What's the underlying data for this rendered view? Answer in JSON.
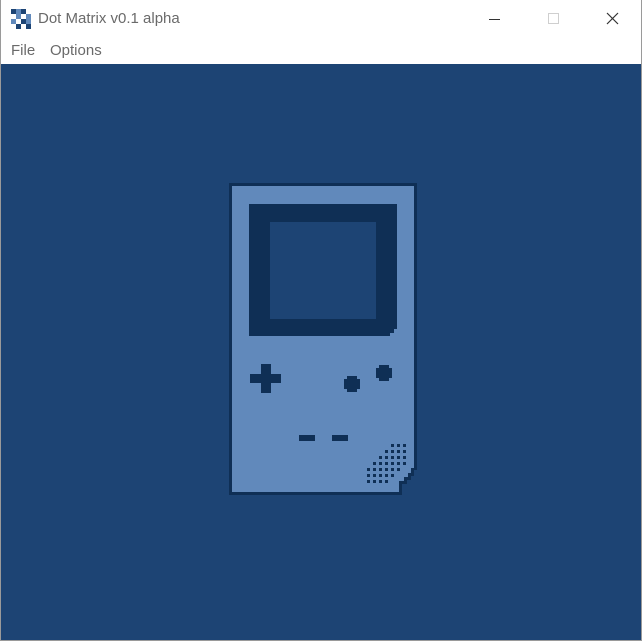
{
  "window": {
    "title": "Dot Matrix v0.1 alpha"
  },
  "menu": {
    "file": "File",
    "options": "Options"
  },
  "colors": {
    "background": "#1d4474",
    "device_body": "#6189bb",
    "device_dark": "#0f2f55",
    "screen_dark": "#1d4474"
  },
  "icons": {
    "app": "checkerboard-icon",
    "minimize": "minimize-icon",
    "maximize": "maximize-icon",
    "close": "close-icon",
    "device": "handheld-console-icon"
  }
}
